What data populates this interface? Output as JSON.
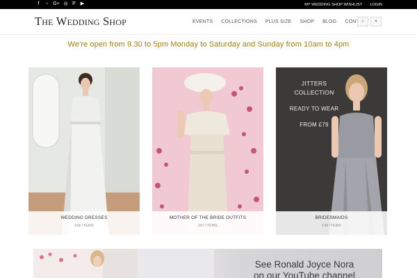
{
  "topbar": {
    "social_icons": [
      "facebook-icon",
      "flickr-icon",
      "google-plus-icon",
      "instagram-icon",
      "pinterest-icon",
      "youtube-icon"
    ],
    "social_glyphs": [
      "f",
      "▫",
      "G+",
      "◎",
      "P",
      "▶"
    ],
    "links": [
      "MY WEDDING SHOP WISHLIST",
      "LOGIN"
    ]
  },
  "header": {
    "logo": "The Wedding Shop",
    "nav": [
      "EVENTS",
      "COLLECTIONS",
      "PLUS SIZE",
      "SHOP",
      "BLOG",
      "CONTACT"
    ],
    "search_glyph": "⌕",
    "cart_glyph": "▼"
  },
  "announcement": "We're open from 9.30 to 5pm Monday to Saturday and Sunday from 10am to 4pm",
  "cards": [
    {
      "title": "WEDDING DRESSES",
      "count": "168 ITEMS"
    },
    {
      "title": "MOTHER OF THE BRIDE OUTFITS",
      "count": "267 ITEMS"
    },
    {
      "title": "BRIDESMAIDS",
      "count": "148 ITEMS"
    }
  ],
  "jitters": {
    "line1": "JITTERS",
    "line2": "COLLECTION",
    "line3": "READY TO WEAR",
    "line4": "FROM £79"
  },
  "banner": {
    "line1": "See Ronald Joyce Nora",
    "line2": "on our YouTube channel"
  },
  "colors": {
    "topbar": "#000000",
    "accent_gold": "#a07b16",
    "logo": "#222222"
  }
}
